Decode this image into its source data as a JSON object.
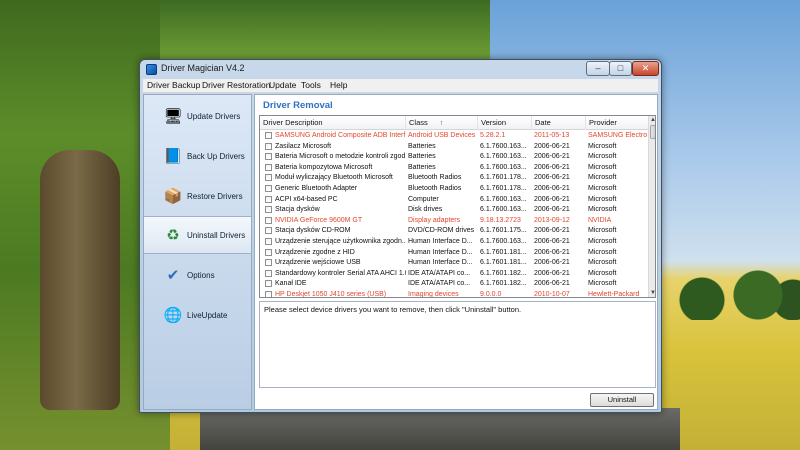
{
  "window": {
    "title": "Driver Magician V4.2",
    "min_glyph": "–",
    "max_glyph": "□",
    "close_glyph": "✕"
  },
  "menu": [
    "Driver Backup",
    "Driver Restoration",
    "Update",
    "Tools",
    "Help"
  ],
  "sidebar": [
    {
      "label": "Update Drivers",
      "icon": "update-drivers-icon",
      "glyph": "🖥",
      "active": false
    },
    {
      "label": "Back Up Drivers",
      "icon": "backup-book-icon",
      "glyph": "📘",
      "active": false
    },
    {
      "label": "Restore Drivers",
      "icon": "restore-box-icon",
      "glyph": "📦",
      "active": false
    },
    {
      "label": "Uninstall Drivers",
      "icon": "recycle-bin-icon",
      "glyph": "♻",
      "active": true
    },
    {
      "label": "Options",
      "icon": "options-icon",
      "glyph": "✔",
      "active": false
    },
    {
      "label": "LiveUpdate",
      "icon": "globe-icon",
      "glyph": "🌐",
      "active": false
    }
  ],
  "panel": {
    "title": "Driver Removal",
    "columns": [
      "Driver Description",
      "Class",
      "Version",
      "Date",
      "Provider"
    ],
    "sort_glyph": "↑",
    "scroll_up_glyph": "▲",
    "scroll_down_glyph": "▼",
    "rows": [
      {
        "desc": "SAMSUNG Android Composite ADB Interf...",
        "class": "Android USB Devices",
        "version": "5.28.2.1",
        "date": "2011-05-13",
        "provider": "SAMSUNG Electro",
        "highlight": true
      },
      {
        "desc": "Zasilacz Microsoft",
        "class": "Batteries",
        "version": "6.1.7600.163...",
        "date": "2006-06-21",
        "provider": "Microsoft",
        "highlight": false
      },
      {
        "desc": "Bateria Microsoft o metodzie kontroli zgod...",
        "class": "Batteries",
        "version": "6.1.7600.163...",
        "date": "2006-06-21",
        "provider": "Microsoft",
        "highlight": false
      },
      {
        "desc": "Bateria kompozytowa Microsoft",
        "class": "Batteries",
        "version": "6.1.7600.163...",
        "date": "2006-06-21",
        "provider": "Microsoft",
        "highlight": false
      },
      {
        "desc": "Moduł wyliczający Bluetooth Microsoft",
        "class": "Bluetooth Radios",
        "version": "6.1.7601.178...",
        "date": "2006-06-21",
        "provider": "Microsoft",
        "highlight": false
      },
      {
        "desc": "Generic Bluetooth Adapter",
        "class": "Bluetooth Radios",
        "version": "6.1.7601.178...",
        "date": "2006-06-21",
        "provider": "Microsoft",
        "highlight": false
      },
      {
        "desc": "ACPI x64-based PC",
        "class": "Computer",
        "version": "6.1.7600.163...",
        "date": "2006-06-21",
        "provider": "Microsoft",
        "highlight": false
      },
      {
        "desc": "Stacja dysków",
        "class": "Disk drives",
        "version": "6.1.7600.163...",
        "date": "2006-06-21",
        "provider": "Microsoft",
        "highlight": false
      },
      {
        "desc": "NVIDIA GeForce 9600M GT",
        "class": "Display adapters",
        "version": "9.18.13.2723",
        "date": "2013-09-12",
        "provider": "NVIDIA",
        "highlight": true
      },
      {
        "desc": "Stacja dysków CD-ROM",
        "class": "DVD/CD-ROM drives",
        "version": "6.1.7601.175...",
        "date": "2006-06-21",
        "provider": "Microsoft",
        "highlight": false
      },
      {
        "desc": "Urządzenie sterujące użytkownika zgodn...",
        "class": "Human Interface D...",
        "version": "6.1.7600.163...",
        "date": "2006-06-21",
        "provider": "Microsoft",
        "highlight": false
      },
      {
        "desc": "Urządzenie zgodne z HID",
        "class": "Human Interface D...",
        "version": "6.1.7601.181...",
        "date": "2006-06-21",
        "provider": "Microsoft",
        "highlight": false
      },
      {
        "desc": "Urządzenie wejściowe USB",
        "class": "Human Interface D...",
        "version": "6.1.7601.181...",
        "date": "2006-06-21",
        "provider": "Microsoft",
        "highlight": false
      },
      {
        "desc": "Standardowy kontroler Serial ATA AHCI 1.0",
        "class": "IDE ATA/ATAPI co...",
        "version": "6.1.7601.182...",
        "date": "2006-06-21",
        "provider": "Microsoft",
        "highlight": false
      },
      {
        "desc": "Kanał IDE",
        "class": "IDE ATA/ATAPI co...",
        "version": "6.1.7601.182...",
        "date": "2006-06-21",
        "provider": "Microsoft",
        "highlight": false
      },
      {
        "desc": "HP Deskjet 1050 J410 series (USB)",
        "class": "Imaging devices",
        "version": "9.0.0.0",
        "date": "2010-10-07",
        "provider": "Hewlett-Packard",
        "highlight": true
      }
    ],
    "info_text": "Please select device drivers you want to remove, then click \"Uninstall\" button.",
    "uninstall_label": "Uninstall"
  },
  "colors": {
    "highlight_text": "#e0472d",
    "panel_title": "#2f72c4"
  }
}
